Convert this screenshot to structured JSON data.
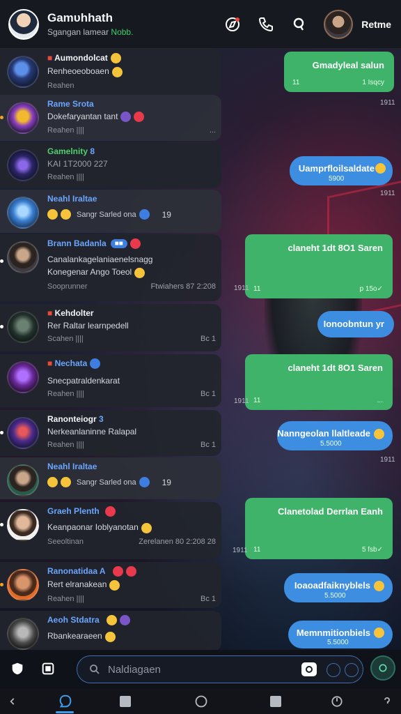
{
  "header": {
    "title": "Gamυhhath",
    "subtitle": "Sgangan lamear",
    "subtitle_accent": "Nobb.",
    "right_label": "Retme"
  },
  "chats": [
    {
      "name": "Aumondolcat",
      "name_color": "#f2f4f8",
      "line": "Renheoeoboaen",
      "meta": "Reahen",
      "status": "",
      "style": "dark"
    },
    {
      "name": "Rame Srota",
      "name_color": "#6aa6ff",
      "line": "Dokefaryantan tant",
      "meta": "Reahen ||||",
      "status": "...",
      "style": "light"
    },
    {
      "name": "Gamelnity",
      "name_color": "#4ed06e",
      "line": "KAI 1T2000 227",
      "meta": "Reahen ||||",
      "status": "",
      "style": "dark"
    },
    {
      "name": "Neahl Iraltae",
      "name_color": "#6aa6ff",
      "line": "Sangr Sarled ona",
      "meta": "",
      "status": "19",
      "style": "light"
    },
    {
      "name": "Brann Badanla",
      "name_color": "#6aa6ff",
      "line": "Canalankagelaniaenelsnagg",
      "line2": "Konegenar Ango Toeol",
      "meta": "Sooprunner",
      "status": "Ftwiahers 87 2:208",
      "style": "dark"
    },
    {
      "name": "Kehdolter",
      "name_color": "#f2f4f8",
      "line": "Rer Raltar learnpedell",
      "meta": "Scahen ||||",
      "status": "Bc 1",
      "style": "dark"
    },
    {
      "name": "Nechata",
      "name_color": "#6aa6ff",
      "line": "Snecpatraldenkarat",
      "meta": "Reahen ||||",
      "status": "Bc 1",
      "style": "dark"
    },
    {
      "name": "Ranonteiogr",
      "name_color": "#f2f4f8",
      "line": "Nerkeanlaninne Ralapal",
      "meta": "Reahen ||||",
      "status": "Bc 1",
      "style": "dark"
    },
    {
      "name": "Neahl Iraltae",
      "name_color": "#6aa6ff",
      "line": "Sangr Sarled ona",
      "meta": "",
      "status": "19",
      "style": "light"
    },
    {
      "name": "Graeh Plenth",
      "name_color": "#6aa6ff",
      "line": "Keanpaonar Ioblyanotan",
      "meta": "Seeoltinan",
      "status": "Zerelanen 80 2:208 28",
      "style": "dark"
    },
    {
      "name": "Ranonatidaa A",
      "name_color": "#6aa6ff",
      "line": "Rert elranakean",
      "meta": "Reahen ||||",
      "status": "Bc 1",
      "style": "dark"
    },
    {
      "name": "Aeoh Stdatra",
      "name_color": "#6aa6ff",
      "line": "Rbankearaeen",
      "meta": "",
      "status": "",
      "style": "dark"
    }
  ],
  "bubbles": [
    {
      "text": "Gmadyleal salun",
      "meta_left": "11",
      "meta_right": "1 Isqcy",
      "kind": "green"
    },
    {
      "text": "Uamprfloilsaldate",
      "meta_right": "5900",
      "kind": "blue"
    },
    {
      "text": "claneht 1dt 8O1 Saren",
      "meta_left": "11",
      "meta_right": "p 15o✓",
      "kind": "green"
    },
    {
      "text": "Ionoobntun yr",
      "kind": "blue"
    },
    {
      "text": "claneht 1dt 8O1 Saren",
      "meta_left": "11",
      "meta_right": "...",
      "kind": "green"
    },
    {
      "text": "Nanngeolan llaltleade",
      "meta_right": "5.5000",
      "kind": "blue"
    },
    {
      "text": "Clanetolad Derrlan Eanh",
      "meta_left": "11",
      "meta_right": "5 fsb✓",
      "kind": "green"
    },
    {
      "text": "Ioaoadfaiknyblels",
      "meta_right": "5.5000",
      "kind": "blue"
    },
    {
      "text": "Memnmitionbiels",
      "meta_right": "5.5000",
      "kind": "blue"
    }
  ],
  "side_times": [
    "1911",
    "1911",
    "1911",
    "1911",
    "1911",
    "1911",
    "1911",
    "1911"
  ],
  "input": {
    "placeholder": "Naldiagaen"
  },
  "colors": {
    "green": "#3fb36a",
    "blue": "#3d8de0",
    "accent": "#3fd06a"
  }
}
